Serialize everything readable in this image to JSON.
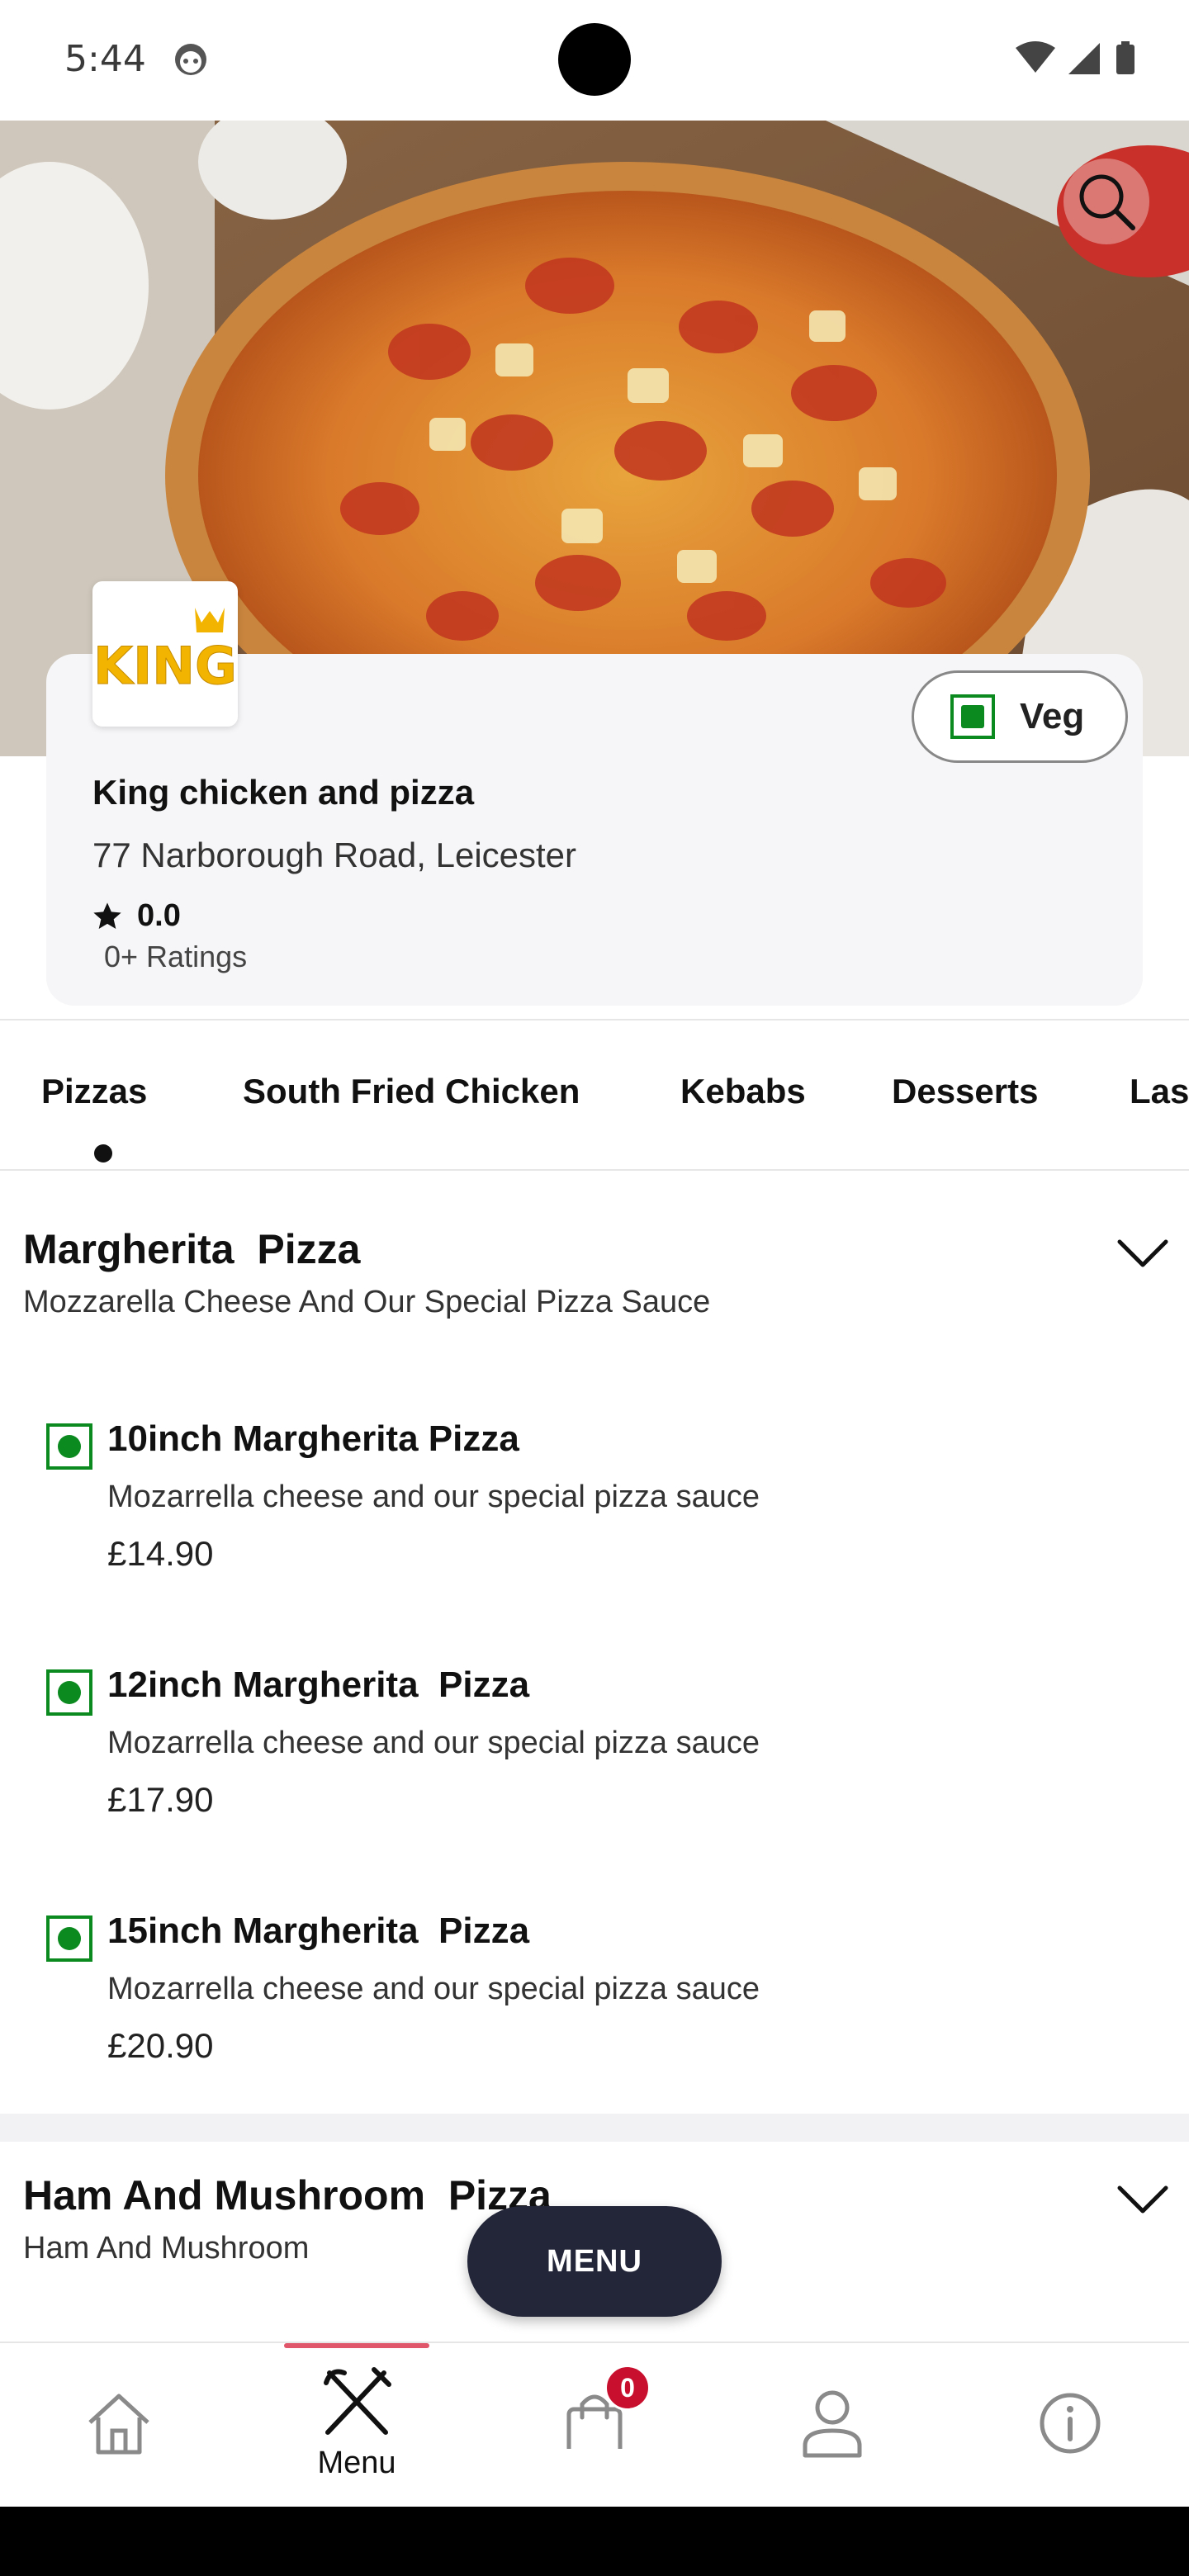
{
  "status_bar": {
    "time": "5:44"
  },
  "restaurant": {
    "logo_text": "KING",
    "name": "King chicken and pizza",
    "address": "77 Narborough Road, Leicester",
    "rating": "0.0",
    "ratings_count": "0+ Ratings",
    "veg_filter_label": "Veg"
  },
  "tabs": [
    {
      "label": "Pizzas"
    },
    {
      "label": "South Fried Chicken"
    },
    {
      "label": "Kebabs"
    },
    {
      "label": "Desserts"
    },
    {
      "label": "Las"
    }
  ],
  "categories": [
    {
      "title": "Margherita  Pizza",
      "description": "Mozzarella Cheese And Our Special Pizza Sauce",
      "items": [
        {
          "name": "10inch Margherita Pizza",
          "description": "Mozarrella cheese and our special pizza sauce",
          "price": "£14.90"
        },
        {
          "name": "12inch Margherita  Pizza",
          "description": "Mozarrella cheese and our special pizza sauce",
          "price": "£17.90"
        },
        {
          "name": "15inch Margherita  Pizza",
          "description": "Mozarrella cheese and our special pizza sauce",
          "price": "£20.90"
        }
      ]
    },
    {
      "title": "Ham And Mushroom  Pizza",
      "description": "Ham And Mushroom"
    }
  ],
  "menu_button": "MENU",
  "bottom_nav": {
    "menu_label": "Menu",
    "cart_count": "0"
  },
  "icons": {
    "search": "search-icon",
    "star": "star-icon",
    "chevron": "chevron-down-icon",
    "home": "home-icon",
    "menu": "fork-knife-icon",
    "cart": "shopping-bag-icon",
    "profile": "person-icon",
    "info": "info-icon"
  },
  "colors": {
    "veg_green": "#0b8a1f",
    "menu_button_bg": "#232639",
    "nav_indicator": "#e0566a",
    "badge_red": "#c8102e"
  }
}
